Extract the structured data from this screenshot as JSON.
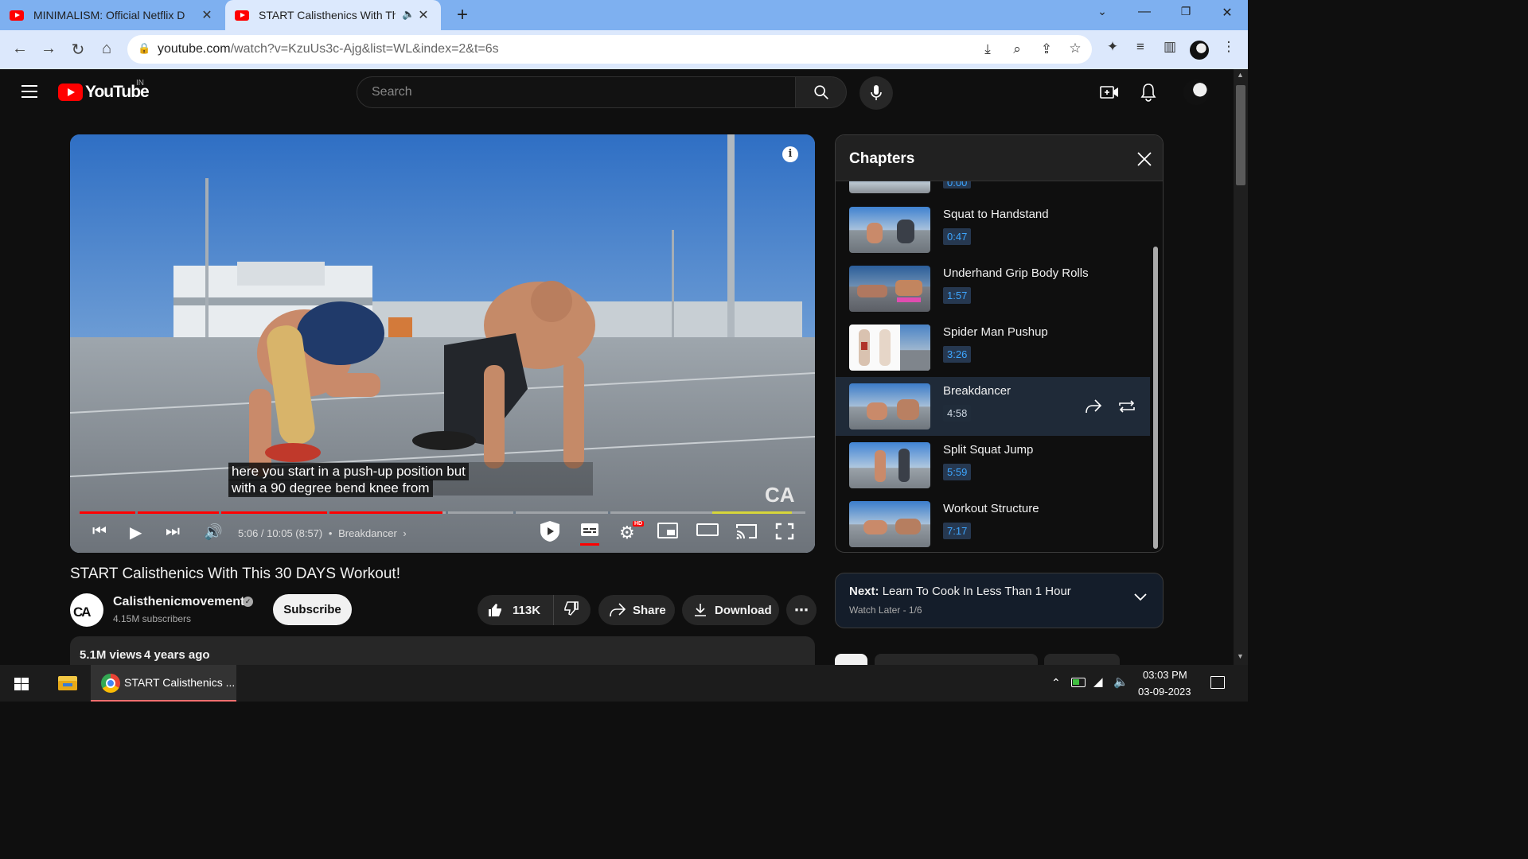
{
  "browser": {
    "tabs": [
      {
        "title": "MINIMALISM: Official Netflix Doc",
        "active": false
      },
      {
        "title": "START Calisthenics With This",
        "active": true
      }
    ],
    "url_host": "youtube.com",
    "url_path": "/watch?v=KzuUs3c-Ajg&list=WL&index=2&t=6s"
  },
  "youtube": {
    "logo_text": "YouTube",
    "country_code": "IN",
    "search_placeholder": "Search"
  },
  "player": {
    "caption_line1": "here you start in a push-up position but",
    "caption_line2": "with a 90 degree bend knee from",
    "time_text": "5:06 / 10:05 (8:57)",
    "chapter_label": "Breakdancer",
    "progress_fraction": 0.5,
    "hd_badge": "HD",
    "watermark": "CA"
  },
  "chapters": {
    "title": "Chapters",
    "partial_ts": "0:00",
    "items": [
      {
        "name": "Squat to Handstand",
        "time": "0:47",
        "active": false
      },
      {
        "name": "Underhand Grip Body Rolls",
        "time": "1:57",
        "active": false
      },
      {
        "name": "Spider Man Pushup",
        "time": "3:26",
        "active": false
      },
      {
        "name": "Breakdancer",
        "time": "4:58",
        "active": true
      },
      {
        "name": "Split Squat Jump",
        "time": "5:59",
        "active": false
      },
      {
        "name": "Workout Structure",
        "time": "7:17",
        "active": false
      }
    ]
  },
  "video": {
    "title": "START Calisthenics With This 30 DAYS Workout!",
    "channel": "Calisthenicmovement",
    "subscribers": "4.15M subscribers",
    "subscribe_label": "Subscribe",
    "likes": "113K",
    "share_label": "Share",
    "download_label": "Download",
    "views": "5.1M views",
    "age": "4 years ago"
  },
  "up_next": {
    "prefix": "Next:",
    "title": "Learn To Cook In Less Than 1 Hour",
    "playlist": "Watch Later - 1/6"
  },
  "taskbar": {
    "app_label": "START Calisthenics ...",
    "time": "03:03 PM",
    "date": "03-09-2023"
  },
  "colors": {
    "accent_red": "#ff0000",
    "link_blue": "#3ea6ff"
  }
}
